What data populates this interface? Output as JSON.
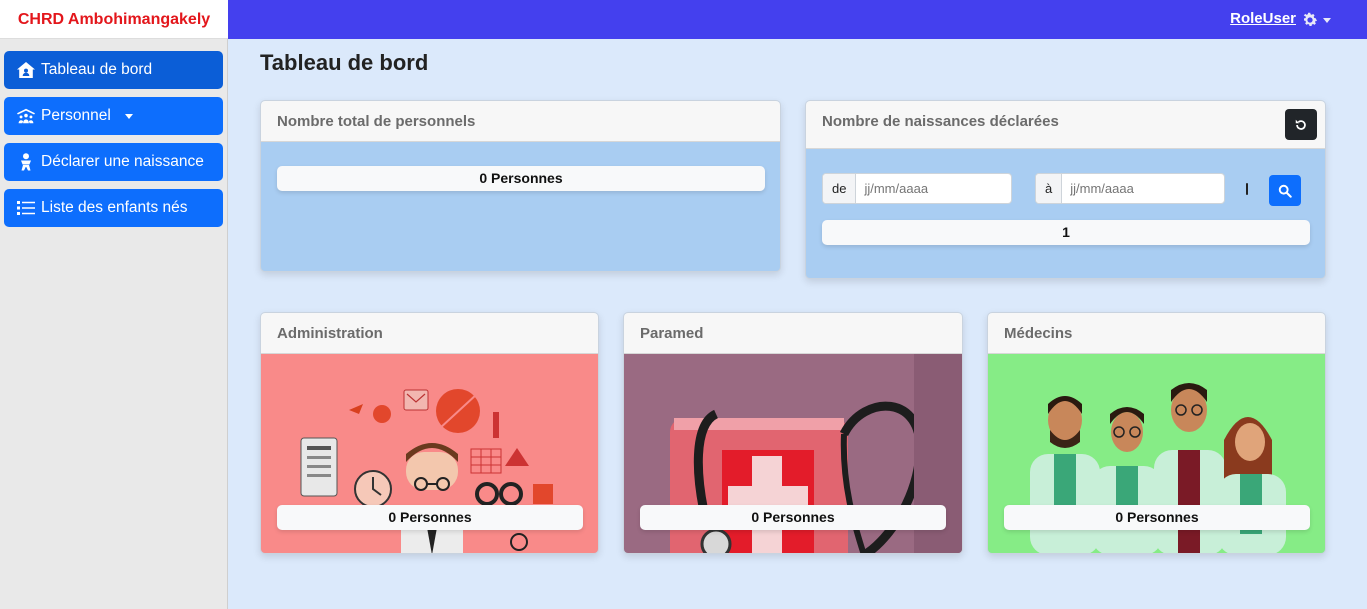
{
  "brand": "CHRD Ambohimangakely",
  "user": {
    "name": "RoleUser",
    "menu_icon": "gear-icon"
  },
  "sidebar": {
    "items": [
      {
        "label": "Tableau de bord",
        "icon": "house-user-icon",
        "active": true
      },
      {
        "label": "Personnel",
        "icon": "people-roof-icon",
        "dropdown": true
      },
      {
        "label": "Déclarer une naissance",
        "icon": "baby-icon"
      },
      {
        "label": "Liste des enfants nés",
        "icon": "list-icon"
      }
    ]
  },
  "page_title": "Tableau de bord",
  "cards": {
    "total_staff": {
      "title": "Nombre total de personnels",
      "value": "0 Personnes"
    },
    "births": {
      "title": "Nombre de naissances déclarées",
      "from_label": "de",
      "to_label": "à",
      "from_placeholder": "jj/mm/aaaa",
      "to_placeholder": "jj/mm/aaaa",
      "value": "1"
    },
    "administration": {
      "title": "Administration",
      "value": "0 Personnes",
      "tint": "#f98a89"
    },
    "paramed": {
      "title": "Paramed",
      "value": "0 Personnes",
      "tint": "#9a6a82"
    },
    "medecins": {
      "title": "Médecins",
      "value": "0 Personnes",
      "tint": "#86ec86"
    }
  },
  "colors": {
    "topbar": "#4440ee",
    "brand_text": "#e3161b",
    "primary": "#0d6efd",
    "card_body": "#a9cdf2",
    "background": "#dbe9fb"
  }
}
